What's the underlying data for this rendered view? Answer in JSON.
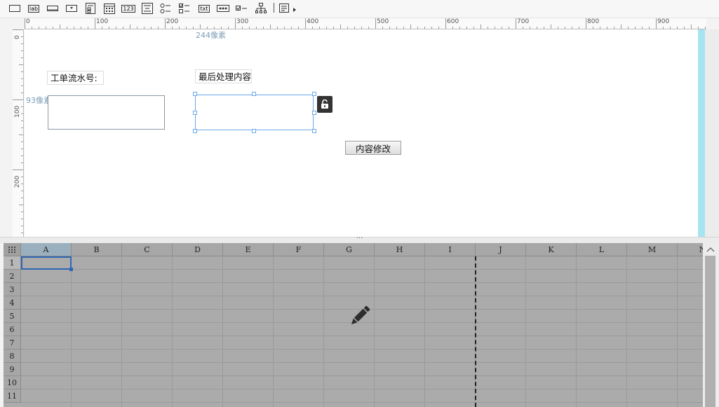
{
  "toolbar": {
    "tools": [
      {
        "icon": "rectangle-icon"
      },
      {
        "icon": "label-icon",
        "text": "lab"
      },
      {
        "icon": "textbox-icon"
      },
      {
        "icon": "dropdown-icon"
      },
      {
        "icon": "form-icon"
      },
      {
        "icon": "calendar-icon"
      },
      {
        "icon": "number-icon",
        "text": "123"
      },
      {
        "icon": "textarea-icon"
      },
      {
        "icon": "radio-group-icon"
      },
      {
        "icon": "checkbox-group-icon"
      },
      {
        "icon": "text-icon",
        "text": "txt"
      },
      {
        "icon": "password-icon"
      },
      {
        "icon": "checkbox-icon"
      },
      {
        "icon": "tree-icon"
      },
      {
        "icon": "more-icon"
      }
    ]
  },
  "ruler": {
    "horizontal": [
      "0",
      "100",
      "200",
      "300",
      "400",
      "500",
      "600",
      "700",
      "800",
      "900"
    ],
    "vertical": [
      "0",
      "100",
      "200"
    ]
  },
  "design": {
    "guide_x": "244像素",
    "guide_y": "93像素",
    "label_serial": "工单流水号:",
    "label_last": "最后处理内容",
    "button_modify": "内容修改",
    "accent": "#a6e4f2",
    "selection_color": "#6aa8e8"
  },
  "splitter": {
    "grip": "···"
  },
  "grid": {
    "columns": [
      "A",
      "B",
      "C",
      "D",
      "E",
      "F",
      "G",
      "H",
      "I",
      "J",
      "K",
      "L",
      "M",
      "N"
    ],
    "rows": [
      "1",
      "2",
      "3",
      "4",
      "5",
      "6",
      "7",
      "8",
      "9",
      "10",
      "11"
    ],
    "selected_cell": "A1",
    "selection_color": "#2f66b3"
  }
}
